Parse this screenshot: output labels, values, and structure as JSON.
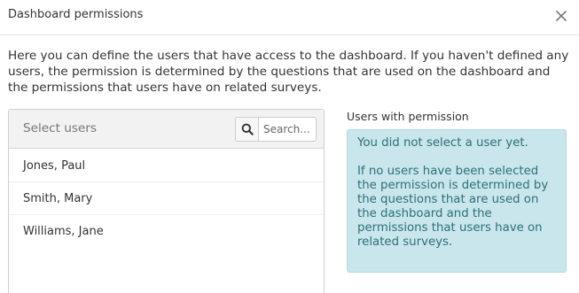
{
  "dialog": {
    "title": "Dashboard permissions",
    "intro": "Here you can define the users that have access to the dashboard. If you haven't defined any users, the permission is determined by the questions that are used on the dashboard and the permissions that users have on related surveys."
  },
  "users_panel": {
    "header_label": "Select users",
    "search": {
      "placeholder": "Search...",
      "value": "",
      "icon": "search-icon"
    },
    "users": [
      {
        "name": "Jones, Paul"
      },
      {
        "name": "Smith, Mary"
      },
      {
        "name": "Williams, Jane"
      }
    ]
  },
  "permissions_panel": {
    "label": "Users with permission",
    "empty_message": "You did not select a user yet.",
    "info_message": "If no users have been selected the permission is determined by the questions that are used on the dashboard and the permissions that users have on related surveys."
  },
  "colors": {
    "info_background": "#c8e6eb",
    "info_text": "#2f6f7a",
    "panel_header": "#f2f2f2"
  }
}
